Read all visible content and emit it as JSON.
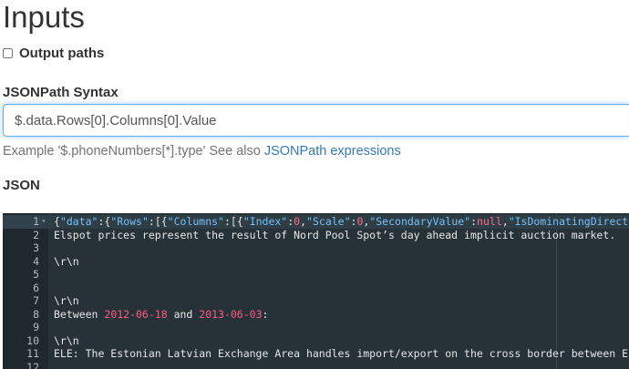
{
  "page": {
    "title": "Inputs"
  },
  "output_paths": {
    "label": "Output paths",
    "checked": false
  },
  "jsonpath": {
    "label": "JSONPath Syntax",
    "value": "$.data.Rows[0].Columns[0].Value",
    "help_prefix": "Example '$.phoneNumbers[*].type' See also ",
    "help_link": "JSONPath expressions"
  },
  "json": {
    "label": "JSON",
    "lines": [
      {
        "num": "1",
        "fold": true,
        "active": true,
        "tokens": [
          {
            "t": "{",
            "c": "punc"
          },
          {
            "t": "\"data\"",
            "c": "str"
          },
          {
            "t": ":{",
            "c": "punc"
          },
          {
            "t": "\"Rows\"",
            "c": "str"
          },
          {
            "t": ":[{",
            "c": "punc"
          },
          {
            "t": "\"Columns\"",
            "c": "str"
          },
          {
            "t": ":[{",
            "c": "punc"
          },
          {
            "t": "\"Index\"",
            "c": "str"
          },
          {
            "t": ":",
            "c": "punc"
          },
          {
            "t": "0",
            "c": "num"
          },
          {
            "t": ",",
            "c": "punc"
          },
          {
            "t": "\"Scale\"",
            "c": "str"
          },
          {
            "t": ":",
            "c": "punc"
          },
          {
            "t": "0",
            "c": "num"
          },
          {
            "t": ",",
            "c": "punc"
          },
          {
            "t": "\"SecondaryValue\"",
            "c": "str"
          },
          {
            "t": ":",
            "c": "punc"
          },
          {
            "t": "null",
            "c": "null"
          },
          {
            "t": ",",
            "c": "punc"
          },
          {
            "t": "\"IsDominatingDirection\"",
            "c": "str"
          }
        ]
      },
      {
        "num": "2",
        "tokens": [
          {
            "t": "Elspot prices represent the result of Nord Pool Spot’s day ahead implicit auction market.",
            "c": "text"
          }
        ]
      },
      {
        "num": "3",
        "tokens": []
      },
      {
        "num": "4",
        "tokens": [
          {
            "t": "\\r\\n",
            "c": "text"
          }
        ]
      },
      {
        "num": "5",
        "tokens": []
      },
      {
        "num": "6",
        "tokens": []
      },
      {
        "num": "7",
        "tokens": [
          {
            "t": "\\r\\n",
            "c": "text"
          }
        ]
      },
      {
        "num": "8",
        "tokens": [
          {
            "t": "Between ",
            "c": "text"
          },
          {
            "t": "2012-06-18",
            "c": "date"
          },
          {
            "t": " and ",
            "c": "text"
          },
          {
            "t": "2013-06-03",
            "c": "date"
          },
          {
            "t": ":",
            "c": "text"
          }
        ]
      },
      {
        "num": "9",
        "tokens": []
      },
      {
        "num": "10",
        "tokens": [
          {
            "t": "\\r\\n",
            "c": "text"
          }
        ]
      },
      {
        "num": "11",
        "tokens": [
          {
            "t": "ELE: The Estonian Latvian Exchange Area handles import/export on the cross border between Es",
            "c": "text"
          }
        ]
      },
      {
        "num": "12",
        "tokens": []
      }
    ]
  }
}
